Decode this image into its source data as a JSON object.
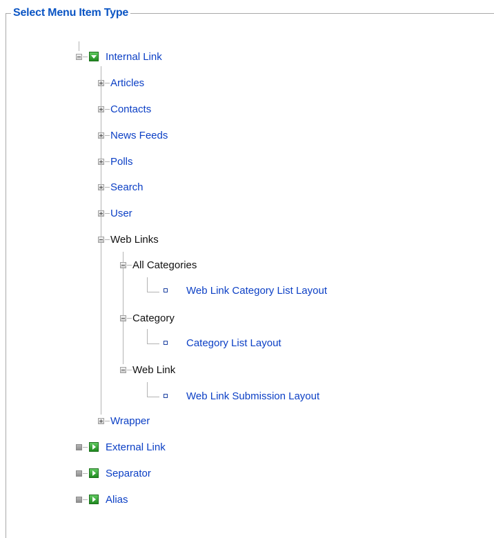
{
  "legend": "Select Menu Item Type",
  "tree": {
    "internal_link": "Internal Link",
    "articles": "Articles",
    "contacts": "Contacts",
    "news_feeds": "News Feeds",
    "polls": "Polls",
    "search": "Search",
    "user": "User",
    "web_links": "Web Links",
    "all_categories": "All Categories",
    "web_link_category_list_layout": "Web Link Category List Layout",
    "category": "Category",
    "category_list_layout": "Category List Layout",
    "web_link": "Web Link",
    "web_link_submission_layout": "Web Link Submission Layout",
    "wrapper": "Wrapper",
    "external_link": "External Link",
    "separator": "Separator",
    "alias": "Alias"
  },
  "colors": {
    "link": "#0b3fc5",
    "legend": "#0b55c4",
    "icon_green": "#2fa32f"
  }
}
